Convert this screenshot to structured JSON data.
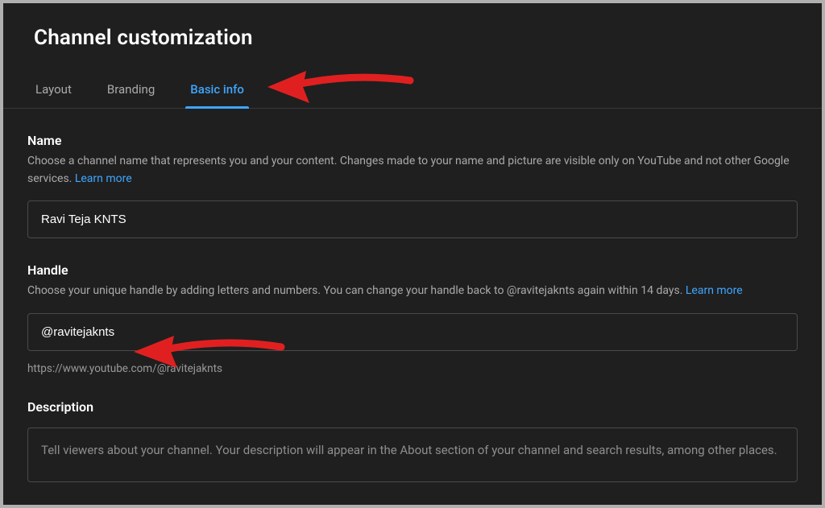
{
  "page": {
    "title": "Channel customization"
  },
  "tabs": {
    "layout": "Layout",
    "branding": "Branding",
    "basic_info": "Basic info"
  },
  "name": {
    "heading": "Name",
    "desc": "Choose a channel name that represents you and your content. Changes made to your name and picture are visible only on YouTube and not other Google services. ",
    "learn_more": "Learn more",
    "value": "Ravi Teja KNTS"
  },
  "handle": {
    "heading": "Handle",
    "desc": "Choose your unique handle by adding letters and numbers. You can change your handle back to @ravitejaknts again within 14 days. ",
    "learn_more": "Learn more",
    "value": "@ravitejaknts",
    "url": "https://www.youtube.com/@ravitejaknts"
  },
  "description": {
    "heading": "Description",
    "placeholder": "Tell viewers about your channel. Your description will appear in the About section of your channel and search results, among other places."
  }
}
